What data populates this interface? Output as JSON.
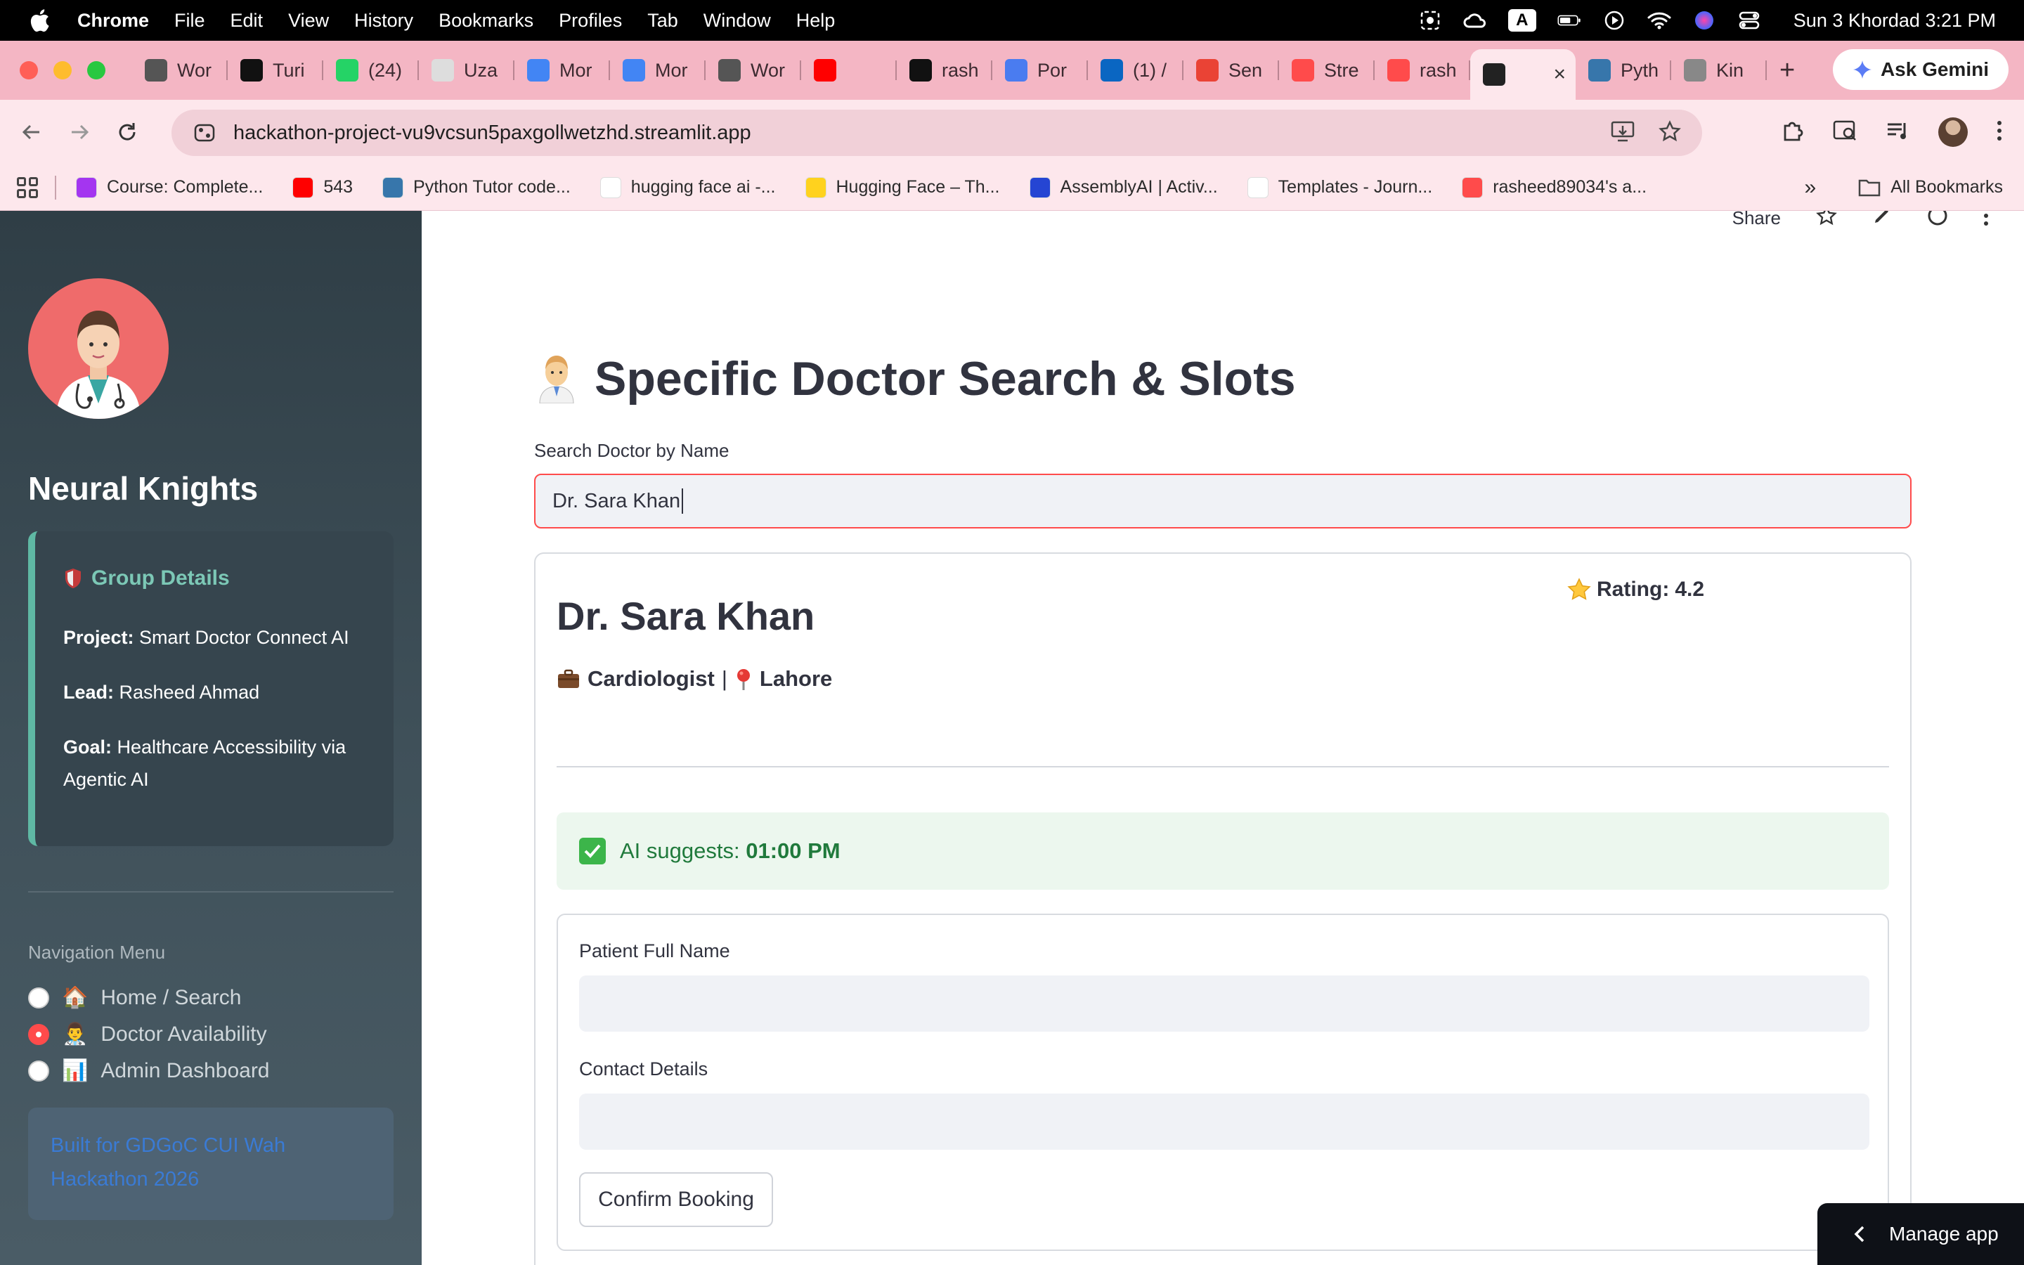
{
  "menubar": {
    "app": "Chrome",
    "items": [
      "File",
      "Edit",
      "View",
      "History",
      "Bookmarks",
      "Profiles",
      "Tab",
      "Window",
      "Help"
    ],
    "clock": "Sun 3 Khordad  3:21 PM",
    "keyboard_badge": "A"
  },
  "tabs": [
    {
      "label": "Wor",
      "icon": "worldcoin-icon",
      "color": "#555555"
    },
    {
      "label": "Turi",
      "icon": "turing-icon",
      "color": "#111111"
    },
    {
      "label": "(24)",
      "icon": "whatsapp-icon",
      "color": "#25d366"
    },
    {
      "label": "Uza",
      "icon": "uza-icon",
      "color": "#dddddd"
    },
    {
      "label": "Mor",
      "icon": "drive-icon",
      "color": "#4285f4"
    },
    {
      "label": "Mor",
      "icon": "drive-icon",
      "color": "#4285f4"
    },
    {
      "label": "Wor",
      "icon": "worldcoin-icon",
      "color": "#555555"
    },
    {
      "label": "",
      "icon": "youtube-icon",
      "color": "#ff0000"
    },
    {
      "label": "rash",
      "icon": "github-icon",
      "color": "#111111"
    },
    {
      "label": "Por",
      "icon": "gemini-icon",
      "color": "#4a7cf0"
    },
    {
      "label": "(1) /",
      "icon": "linkedin-icon",
      "color": "#0a66c2"
    },
    {
      "label": "Sen",
      "icon": "gmail-icon",
      "color": "#ea4335"
    },
    {
      "label": "Stre",
      "icon": "streamlit-icon",
      "color": "#ff4b4b"
    },
    {
      "label": "rash",
      "icon": "streamlit-icon",
      "color": "#ff4b4b"
    },
    {
      "label": "",
      "icon": "streamlit-dark-icon",
      "color": "#222222",
      "active": true
    },
    {
      "label": "Pyth",
      "icon": "python-icon",
      "color": "#3776ab"
    },
    {
      "label": "Kin",
      "icon": "kindle-icon",
      "color": "#888888"
    }
  ],
  "ask_gemini": "Ask Gemini",
  "address": {
    "url": "hackathon-project-vu9vcsun5paxgollwetzhd.streamlit.app"
  },
  "bookmarks": [
    {
      "label": "Course: Complete...",
      "icon": "udemy-icon",
      "color": "#a435f0"
    },
    {
      "label": "543",
      "icon": "youtube-icon",
      "color": "#ff0000"
    },
    {
      "label": "Python Tutor code...",
      "icon": "python-icon",
      "color": "#3776ab"
    },
    {
      "label": "hugging face ai -...",
      "icon": "google-icon",
      "color": "#ffffff"
    },
    {
      "label": "Hugging Face – Th...",
      "icon": "huggingface-icon",
      "color": "#ffd21e"
    },
    {
      "label": "AssemblyAI | Activ...",
      "icon": "assemblyai-icon",
      "color": "#2545d3"
    },
    {
      "label": "Templates - Journ...",
      "icon": "journal-icon",
      "color": "#ffffff"
    },
    {
      "label": "rasheed89034's a...",
      "icon": "streamlit-icon",
      "color": "#ff4b4b"
    }
  ],
  "all_bookmarks": "All Bookmarks",
  "sidebar": {
    "team_name": "Neural Knights",
    "group_title": "Group Details",
    "project_label": "Project:",
    "project_value": "Smart Doctor Connect AI",
    "lead_label": "Lead:",
    "lead_value": "Rasheed Ahmad",
    "goal_label": "Goal:",
    "goal_value": "Healthcare Accessibility via Agentic AI",
    "nav_label": "Navigation Menu",
    "nav_items": [
      {
        "emoji": "🏠",
        "label": "Home / Search",
        "checked": false
      },
      {
        "emoji": "👨‍⚕️",
        "label": "Doctor Availability",
        "checked": true
      },
      {
        "emoji": "📊",
        "label": "Admin Dashboard",
        "checked": false
      }
    ],
    "built_for": "Built for GDGoC CUI Wah Hackathon 2026"
  },
  "main": {
    "share": "Share",
    "title": "Specific Doctor Search & Slots",
    "search_label": "Search Doctor by Name",
    "search_value": "Dr. Sara Khan",
    "doctor": {
      "name": "Dr. Sara Khan",
      "rating_label": "Rating:",
      "rating_value": "4.2",
      "specialty": "Cardiologist",
      "separator": "|",
      "city": "Lahore"
    },
    "ai_prefix": "AI suggests:",
    "ai_time": "01:00 PM",
    "form": {
      "name_label": "Patient Full Name",
      "name_value": "",
      "contact_label": "Contact Details",
      "contact_value": "",
      "submit": "Confirm Booking"
    }
  },
  "manage_app": "Manage app",
  "colors": {
    "accent": "#ff4b4b",
    "success_bg": "#ecf7ee",
    "success_text": "#207a3c",
    "sidebar": "#2f3e46",
    "tabstrip": "#f4b6c4"
  }
}
